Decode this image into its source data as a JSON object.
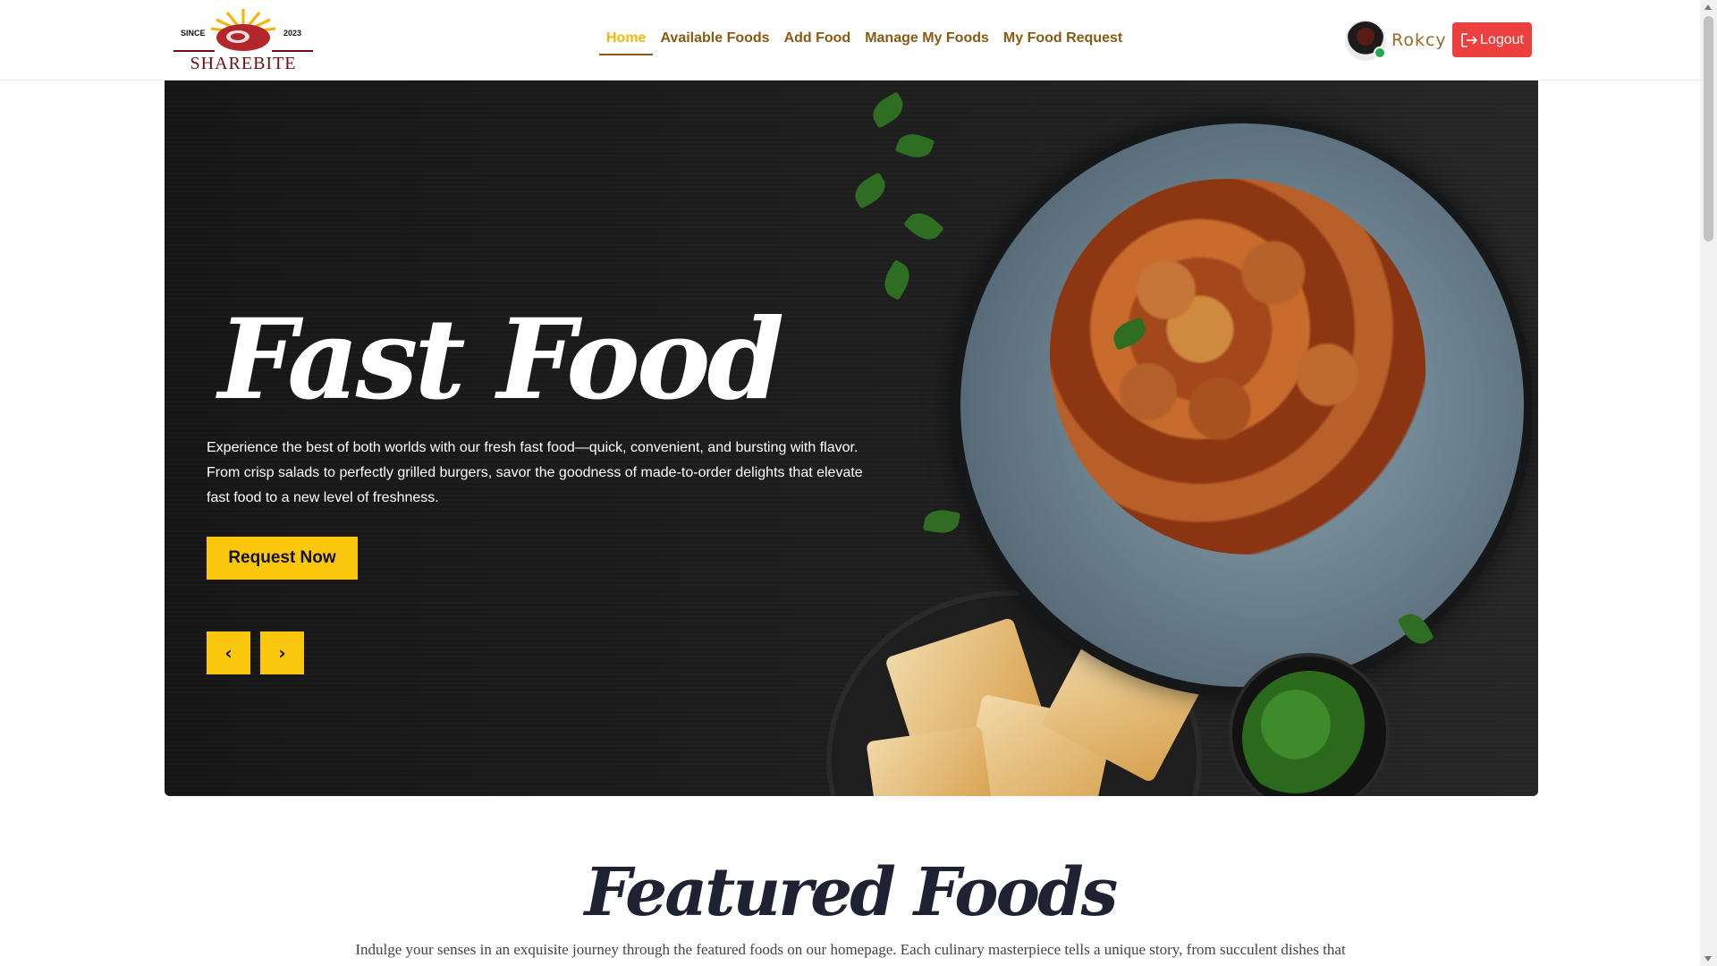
{
  "header": {
    "logo": {
      "since": "SINCE",
      "year": "2023",
      "brand": "SHAREBITE"
    },
    "nav": [
      {
        "label": "Home",
        "active": true
      },
      {
        "label": "Available Foods",
        "active": false
      },
      {
        "label": "Add Food",
        "active": false
      },
      {
        "label": "Manage My Foods",
        "active": false
      },
      {
        "label": "My Food Request",
        "active": false
      }
    ],
    "user": {
      "name": "Rokcy",
      "status_color": "#1faa4b"
    },
    "logout_label": "Logout"
  },
  "hero": {
    "title": "Fast Food",
    "description": "Experience the best of both worlds with our fresh fast food—quick, convenient, and bursting with flavor. From crisp salads to perfectly grilled burgers, savor the goodness of made-to-order delights that elevate fast food to a new level of freshness.",
    "cta_label": "Request Now",
    "prev_label": "‹",
    "next_label": "›"
  },
  "featured": {
    "title": "Featured Foods",
    "description": "Indulge your senses in an exquisite journey through the featured foods on our homepage. Each culinary masterpiece tells a unique story, from succulent dishes that"
  },
  "colors": {
    "accent": "#fbc70d",
    "nav_text": "#8a5a12",
    "nav_active": "#f2b90c",
    "logout": "#ee3f3f"
  }
}
